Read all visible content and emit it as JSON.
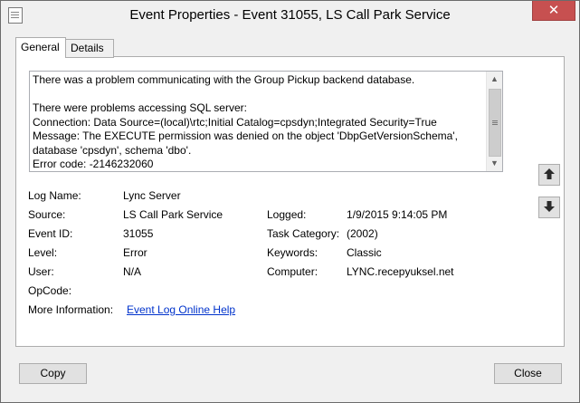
{
  "window": {
    "title": "Event Properties - Event 31055, LS Call Park Service",
    "close_glyph": "✕"
  },
  "tabs": [
    {
      "label": "General",
      "active": true
    },
    {
      "label": "Details",
      "active": false
    }
  ],
  "description": "There was a problem communicating with the Group Pickup backend database.\n\nThere were problems accessing SQL server:\nConnection: Data Source=(local)\\rtc;Initial Catalog=cpsdyn;Integrated Security=True\nMessage: The EXECUTE permission was denied on the object 'DbpGetVersionSchema',\ndatabase 'cpsdyn', schema 'dbo'.\nError code: -2146232060",
  "fields": {
    "log_name": {
      "label": "Log Name:",
      "value": "Lync Server"
    },
    "source": {
      "label": "Source:",
      "value": "LS Call Park Service"
    },
    "logged": {
      "label": "Logged:",
      "value": "1/9/2015 9:14:05 PM"
    },
    "event_id": {
      "label": "Event ID:",
      "value": "31055"
    },
    "task_category": {
      "label": "Task Category:",
      "value": "(2002)"
    },
    "level": {
      "label": "Level:",
      "value": "Error"
    },
    "keywords": {
      "label": "Keywords:",
      "value": "Classic"
    },
    "user": {
      "label": "User:",
      "value": "N/A"
    },
    "computer": {
      "label": "Computer:",
      "value": "LYNC.recepyuksel.net"
    },
    "opcode": {
      "label": "OpCode:",
      "value": ""
    },
    "more_info": {
      "label": "More Information:",
      "link": "Event Log Online Help"
    }
  },
  "buttons": {
    "copy": "Copy",
    "close": "Close"
  },
  "icons": {
    "up_arrow": "arrow-up-icon",
    "down_arrow": "arrow-down-icon"
  }
}
